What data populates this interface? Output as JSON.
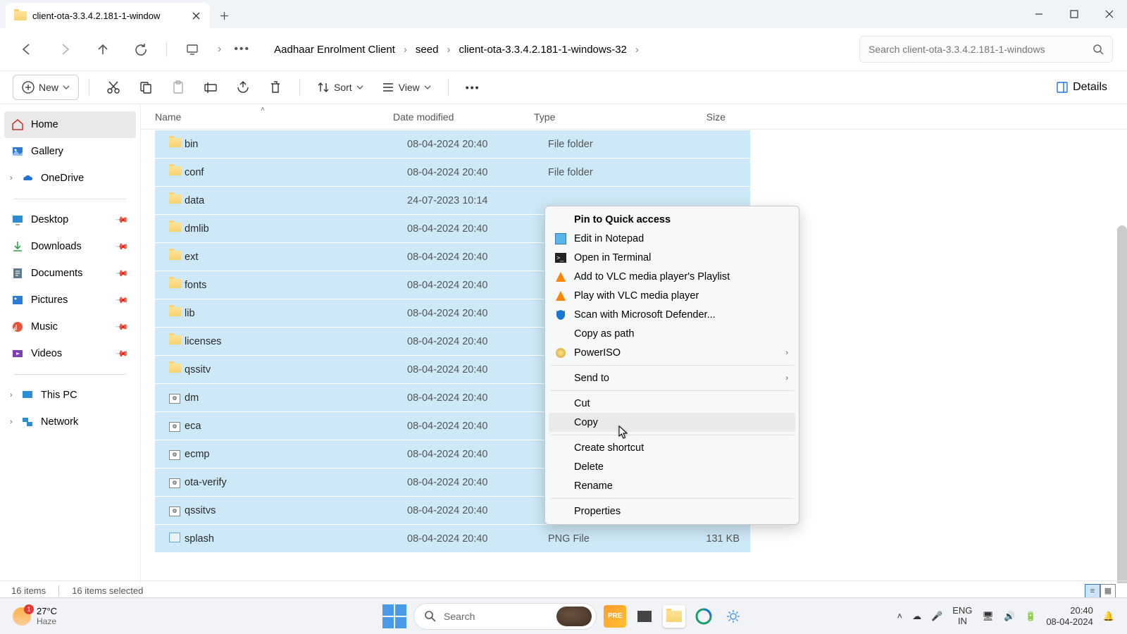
{
  "tab_title": "client-ota-3.3.4.2.181-1-window",
  "breadcrumb": [
    "Aadhaar Enrolment Client",
    "seed",
    "client-ota-3.3.4.2.181-1-windows-32"
  ],
  "search_placeholder": "Search client-ota-3.3.4.2.181-1-windows",
  "toolbar": {
    "new": "New",
    "sort": "Sort",
    "view": "View",
    "details": "Details"
  },
  "sidebar": {
    "home": "Home",
    "gallery": "Gallery",
    "onedrive": "OneDrive",
    "desktop": "Desktop",
    "downloads": "Downloads",
    "documents": "Documents",
    "pictures": "Pictures",
    "music": "Music",
    "videos": "Videos",
    "thispc": "This PC",
    "network": "Network"
  },
  "columns": {
    "name": "Name",
    "date": "Date modified",
    "type": "Type",
    "size": "Size"
  },
  "rows": [
    {
      "icon": "folder",
      "name": "bin",
      "date": "08-04-2024 20:40",
      "type": "File folder",
      "size": ""
    },
    {
      "icon": "folder",
      "name": "conf",
      "date": "08-04-2024 20:40",
      "type": "File folder",
      "size": ""
    },
    {
      "icon": "folder",
      "name": "data",
      "date": "24-07-2023 10:14",
      "type": "",
      "size": ""
    },
    {
      "icon": "folder",
      "name": "dmlib",
      "date": "08-04-2024 20:40",
      "type": "",
      "size": ""
    },
    {
      "icon": "folder",
      "name": "ext",
      "date": "08-04-2024 20:40",
      "type": "",
      "size": ""
    },
    {
      "icon": "folder",
      "name": "fonts",
      "date": "08-04-2024 20:40",
      "type": "",
      "size": ""
    },
    {
      "icon": "folder",
      "name": "lib",
      "date": "08-04-2024 20:40",
      "type": "",
      "size": ""
    },
    {
      "icon": "folder",
      "name": "licenses",
      "date": "08-04-2024 20:40",
      "type": "",
      "size": ""
    },
    {
      "icon": "folder",
      "name": "qssitv",
      "date": "08-04-2024 20:40",
      "type": "",
      "size": ""
    },
    {
      "icon": "batch",
      "name": "dm",
      "date": "08-04-2024 20:40",
      "type": "",
      "size": ""
    },
    {
      "icon": "batch",
      "name": "eca",
      "date": "08-04-2024 20:40",
      "type": "",
      "size": ""
    },
    {
      "icon": "batch",
      "name": "ecmp",
      "date": "08-04-2024 20:40",
      "type": "",
      "size": ""
    },
    {
      "icon": "batch",
      "name": "ota-verify",
      "date": "08-04-2024 20:40",
      "type": "",
      "size": ""
    },
    {
      "icon": "batch",
      "name": "qssitvs",
      "date": "08-04-2024 20:40",
      "type": "",
      "size": ""
    },
    {
      "icon": "png",
      "name": "splash",
      "date": "08-04-2024 20:40",
      "type": "PNG File",
      "size": "131 KB"
    }
  ],
  "context_menu": [
    {
      "label": "Pin to Quick access",
      "icon": "",
      "bold": true
    },
    {
      "label": "Edit in Notepad",
      "icon": "notepad"
    },
    {
      "label": "Open in Terminal",
      "icon": "terminal"
    },
    {
      "label": "Add to VLC media player's Playlist",
      "icon": "vlc"
    },
    {
      "label": "Play with VLC media player",
      "icon": "vlc"
    },
    {
      "label": "Scan with Microsoft Defender...",
      "icon": "shield"
    },
    {
      "label": "Copy as path",
      "icon": ""
    },
    {
      "label": "PowerISO",
      "icon": "poweriso",
      "submenu": true
    },
    {
      "sep": true
    },
    {
      "label": "Send to",
      "icon": "",
      "submenu": true
    },
    {
      "sep": true
    },
    {
      "label": "Cut",
      "icon": ""
    },
    {
      "label": "Copy",
      "icon": "",
      "hover": true
    },
    {
      "sep": true
    },
    {
      "label": "Create shortcut",
      "icon": ""
    },
    {
      "label": "Delete",
      "icon": ""
    },
    {
      "label": "Rename",
      "icon": ""
    },
    {
      "sep": true
    },
    {
      "label": "Properties",
      "icon": ""
    }
  ],
  "status": {
    "items": "16 items",
    "selected": "16 items selected"
  },
  "taskbar": {
    "temp": "27°C",
    "cond": "Haze",
    "badge": "1",
    "search": "Search",
    "lang1": "ENG",
    "lang2": "IN",
    "time": "20:40",
    "date": "08-04-2024"
  }
}
